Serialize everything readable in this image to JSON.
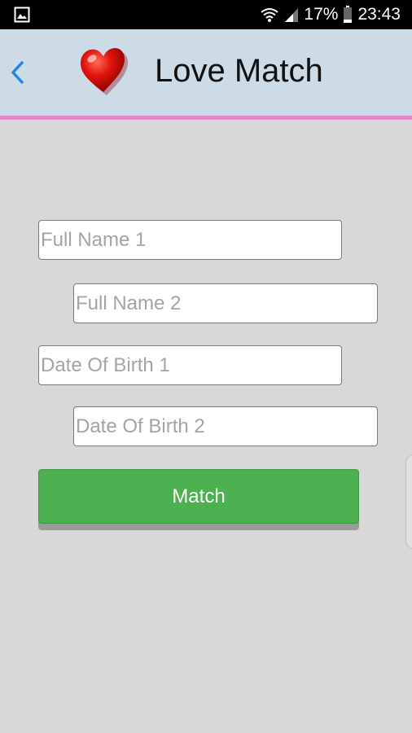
{
  "status_bar": {
    "battery_percent": "17%",
    "time": "23:43",
    "icons": [
      "gallery-icon",
      "wifi-icon",
      "signal-icon",
      "battery-icon"
    ]
  },
  "app_bar": {
    "title": "Love Match",
    "back_icon": "back-chevron-icon",
    "logo_icon": "heart-icon",
    "accent_color": "#e987c8",
    "background_color": "#ccdbe5"
  },
  "form": {
    "name1_placeholder": "Full Name 1",
    "name2_placeholder": "Full Name 2",
    "dob1_placeholder": "Date Of Birth 1",
    "dob2_placeholder": "Date Of Birth 2",
    "match_label": "Match",
    "match_color": "#4caf50"
  }
}
